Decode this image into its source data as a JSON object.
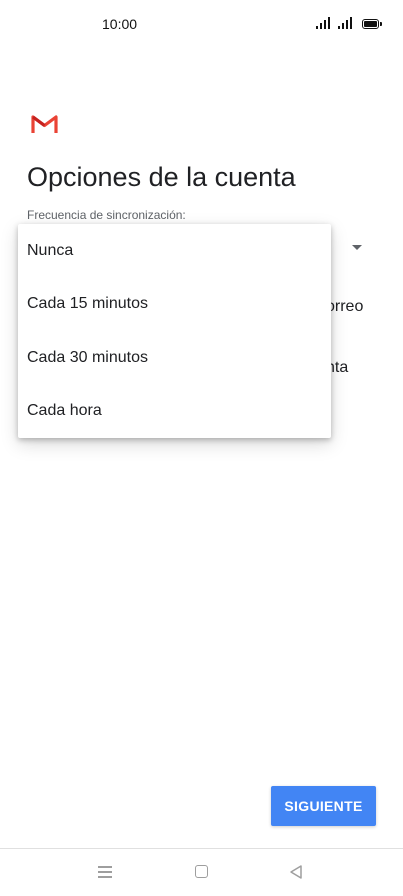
{
  "status_bar": {
    "time": "10:00"
  },
  "app": {
    "icon": "gmail-icon",
    "brand_colors": [
      "#ea4335",
      "#c5221f"
    ]
  },
  "header": {
    "title": "Opciones de la cuenta"
  },
  "sync_frequency": {
    "label": "Frecuencia de sincronización:",
    "options": [
      "Nunca",
      "Cada 15 minutos",
      "Cada 30 minutos",
      "Cada hora"
    ]
  },
  "background_text": {
    "line1": "orreo",
    "line2": "nta"
  },
  "footer": {
    "next_label": "SIGUIENTE",
    "accent_color": "#4285f4"
  },
  "nav_bar": {
    "icons": [
      "menu-icon",
      "home-icon",
      "back-icon"
    ]
  }
}
